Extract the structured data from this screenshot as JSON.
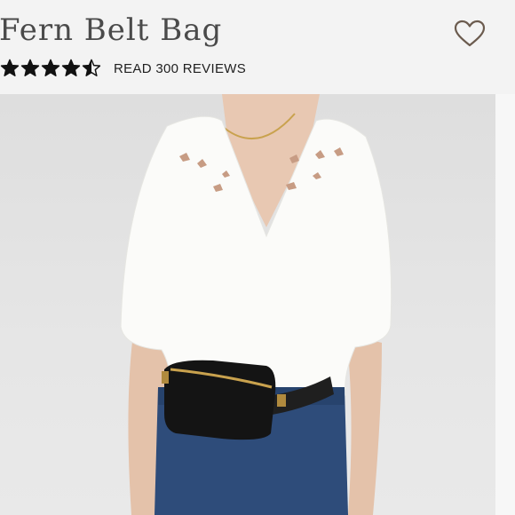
{
  "product": {
    "title": "Fern Belt Bag",
    "rating": 4.5,
    "rating_max": 5,
    "reviews_link": "READ 300 REVIEWS",
    "favorite_icon": "heart-outline-icon"
  },
  "colors": {
    "title": "#4a4a4a",
    "stars": "#111111",
    "background": "#f3f3f3"
  }
}
